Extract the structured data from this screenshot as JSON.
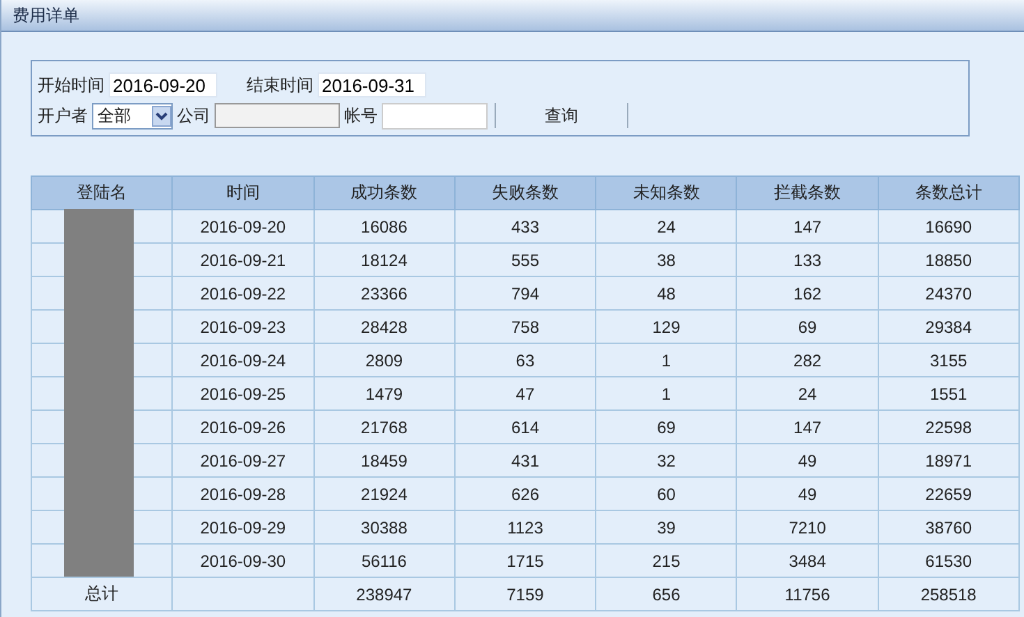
{
  "window": {
    "title": "费用详单"
  },
  "filters": {
    "start_label": "开始时间",
    "start_value": "2016-09-20",
    "end_label": "结束时间",
    "end_value": "2016-09-31",
    "owner_label": "开户者",
    "owner_value": "全部",
    "company_label": "公司",
    "account_label": "帐号",
    "query_button": "查询"
  },
  "table": {
    "columns": [
      "登陆名",
      "时间",
      "成功条数",
      "失败条数",
      "未知条数",
      "拦截条数",
      "条数总计"
    ],
    "rows": [
      {
        "time": "2016-09-20",
        "values": [
          "16086",
          "433",
          "24",
          "147",
          "16690"
        ]
      },
      {
        "time": "2016-09-21",
        "values": [
          "18124",
          "555",
          "38",
          "133",
          "18850"
        ]
      },
      {
        "time": "2016-09-22",
        "values": [
          "23366",
          "794",
          "48",
          "162",
          "24370"
        ]
      },
      {
        "time": "2016-09-23",
        "values": [
          "28428",
          "758",
          "129",
          "69",
          "29384"
        ]
      },
      {
        "time": "2016-09-24",
        "values": [
          "2809",
          "63",
          "1",
          "282",
          "3155"
        ]
      },
      {
        "time": "2016-09-25",
        "values": [
          "1479",
          "47",
          "1",
          "24",
          "1551"
        ]
      },
      {
        "time": "2016-09-26",
        "values": [
          "21768",
          "614",
          "69",
          "147",
          "22598"
        ]
      },
      {
        "time": "2016-09-27",
        "values": [
          "18459",
          "431",
          "32",
          "49",
          "18971"
        ]
      },
      {
        "time": "2016-09-28",
        "values": [
          "21924",
          "626",
          "60",
          "49",
          "22659"
        ]
      },
      {
        "time": "2016-09-29",
        "values": [
          "30388",
          "1123",
          "39",
          "7210",
          "38760"
        ]
      },
      {
        "time": "2016-09-30",
        "values": [
          "56116",
          "1715",
          "215",
          "3484",
          "61530"
        ]
      }
    ],
    "total": {
      "label": "总计",
      "values": [
        "238947",
        "7159",
        "656",
        "11756",
        "258518"
      ]
    }
  }
}
